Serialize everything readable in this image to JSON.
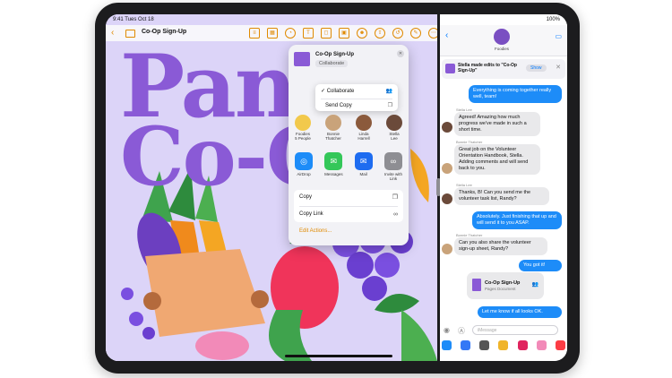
{
  "status": {
    "time": "9:41",
    "date": "Tues Oct 18",
    "battery": "100%"
  },
  "pages": {
    "doc_title": "Co-Op Sign-Up",
    "headline_line1": "Pan",
    "headline_line2": "Co-O",
    "accent": "#e08a00",
    "headline_color": "#8a5ad6"
  },
  "share": {
    "title": "Co-Op Sign-Up",
    "mode": "Collaborate",
    "menu": [
      {
        "label": "Collaborate",
        "icon": "people-icon"
      },
      {
        "label": "Send Copy",
        "icon": "copy-icon"
      }
    ],
    "people": [
      {
        "name": "Foodies",
        "sub": "5 People",
        "color": "#f2c94c"
      },
      {
        "name": "Bonnie",
        "sub": "Thatcher",
        "color": "#c9a37a"
      },
      {
        "name": "Linda",
        "sub": "Harrell",
        "color": "#8b5a3c"
      },
      {
        "name": "Stella",
        "sub": "Lee",
        "color": "#6b4a3a"
      }
    ],
    "apps": [
      {
        "label": "AirDrop",
        "color": "#1d8cf8",
        "glyph": "◎"
      },
      {
        "label": "Messages",
        "color": "#34c759",
        "glyph": "✉"
      },
      {
        "label": "Mail",
        "color": "#1e6cf0",
        "glyph": "✉"
      },
      {
        "label": "Invite with Link",
        "color": "#8e8e93",
        "glyph": "∞"
      }
    ],
    "actions": [
      {
        "label": "Copy",
        "icon": "copy-icon"
      },
      {
        "label": "Copy Link",
        "icon": "link-icon"
      }
    ],
    "edit_actions": "Edit Actions..."
  },
  "messages": {
    "group_name": "Foodies",
    "notice": "Stella made edits to \"Co-Op Sign-Up\"",
    "notice_show": "Show",
    "thread": [
      {
        "dir": "out",
        "text": "Everything is coming together really well, team!"
      },
      {
        "dir": "in",
        "sender": "Stella Lee",
        "text": "Agreed! Amazing how much progress we've made in such a short time."
      },
      {
        "dir": "in",
        "sender": "Bonnie Thatcher",
        "text": "Great job on the Volunteer Orientation Handbook, Stella. Adding comments and will send back to you."
      },
      {
        "dir": "in",
        "sender": "Stella Lee",
        "text": "Thanks, B! Can you send me the volunteer task list, Randy?"
      },
      {
        "dir": "out",
        "text": "Absolutely. Just finishing that up and will send it to you ASAP."
      },
      {
        "dir": "in",
        "sender": "Bonnie Thatcher",
        "text": "Can you also share the volunteer sign-up sheet, Randy?"
      },
      {
        "dir": "out",
        "text": "You got it!"
      },
      {
        "dir": "out",
        "text": "Let me know if all looks OK."
      }
    ],
    "doc_card": {
      "name": "Co-Op Sign-Up",
      "kind": "Pages Document"
    },
    "compose_placeholder": "iMessage",
    "accent": "#007aff"
  }
}
